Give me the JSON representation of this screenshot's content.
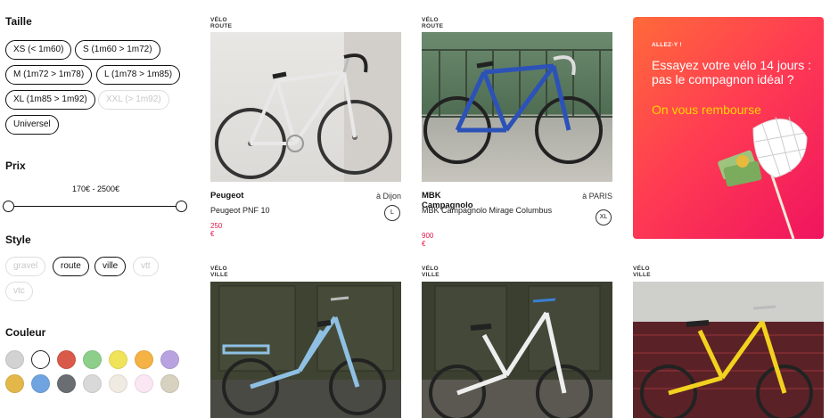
{
  "filters": {
    "size": {
      "title": "Taille",
      "options": [
        {
          "label": "XS (< 1m60)",
          "enabled": true
        },
        {
          "label": "S (1m60 > 1m72)",
          "enabled": true
        },
        {
          "label": "M (1m72 > 1m78)",
          "enabled": true
        },
        {
          "label": "L (1m78 > 1m85)",
          "enabled": true
        },
        {
          "label": "XL (1m85 > 1m92)",
          "enabled": true
        },
        {
          "label": "XXL (> 1m92)",
          "enabled": false
        },
        {
          "label": "Universel",
          "enabled": true
        }
      ]
    },
    "price": {
      "title": "Prix",
      "range_label": "170€ - 2500€"
    },
    "style": {
      "title": "Style",
      "options": [
        {
          "label": "gravel",
          "enabled": false
        },
        {
          "label": "route",
          "enabled": true
        },
        {
          "label": "ville",
          "enabled": true
        },
        {
          "label": "vtt",
          "enabled": false
        },
        {
          "label": "vtc",
          "enabled": false
        }
      ]
    },
    "color": {
      "title": "Couleur",
      "swatches": [
        {
          "name": "grey",
          "hex": "#d2d2d2"
        },
        {
          "name": "white",
          "hex": "#ffffff"
        },
        {
          "name": "red",
          "hex": "#d95a48"
        },
        {
          "name": "green",
          "hex": "#8dcf8a"
        },
        {
          "name": "yellow",
          "hex": "#f0e35a"
        },
        {
          "name": "orange",
          "hex": "#f5b245"
        },
        {
          "name": "purple",
          "hex": "#b8a3e0"
        },
        {
          "name": "mustard",
          "hex": "#e3b74a"
        },
        {
          "name": "blue",
          "hex": "#6fa4e0"
        },
        {
          "name": "dark-grey",
          "hex": "#6a6e72"
        },
        {
          "name": "silver",
          "hex": "#d9d9d9"
        },
        {
          "name": "cream",
          "hex": "#f0ebe2"
        },
        {
          "name": "pink",
          "hex": "#fbe6f4"
        },
        {
          "name": "beige",
          "hex": "#d7d1c0"
        }
      ]
    }
  },
  "products": [
    {
      "category": "VÉLO ROUTE",
      "brand": "Peugeot",
      "location": "à Dijon",
      "model": "Peugeot PNF 10",
      "price": "250 €",
      "size": "L"
    },
    {
      "category": "VÉLO ROUTE",
      "brand": "MBK Campagnolo",
      "location": "à PARIS",
      "model": "MBK Campagnolo Mirage Columbus",
      "price": "900 €",
      "size": "XL"
    },
    {
      "category": "VÉLO VILLE"
    },
    {
      "category": "VÉLO VILLE"
    },
    {
      "category": "VÉLO VILLE"
    }
  ],
  "promo": {
    "eyebrow": "ALLEZ-Y !",
    "headline": "Essayez votre vélo 14 jours : pas le compagnon idéal ?",
    "accent": "On vous rembourse"
  },
  "colors": {
    "accent": "#e4194d",
    "promo_yellow": "#ffd500"
  }
}
